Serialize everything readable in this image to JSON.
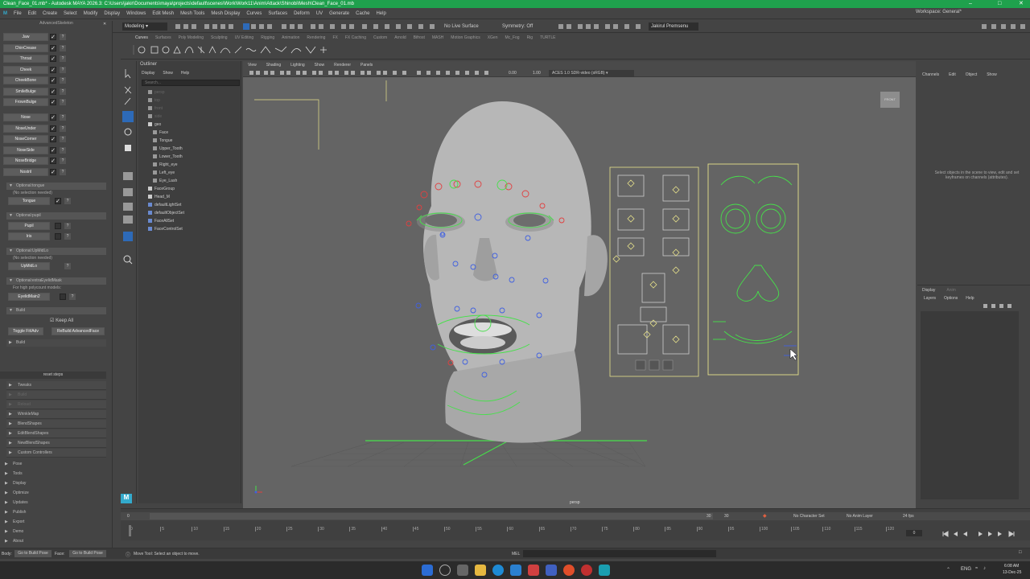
{
  "window": {
    "title": "Clean_Face_01.mb* - Autodesk MAYA 2026.3: C:\\Users\\jakir\\Documents\\maya\\projects\\default\\scenes\\Work\\Work11\\Anim\\Attack\\Shinobi\\Mesh\\Clean_Face_01.mb",
    "workspace_label": "Workspace:",
    "workspace_value": "General*"
  },
  "menubar": [
    "File",
    "Edit",
    "Create",
    "Select",
    "Modify",
    "Display",
    "Windows",
    "Edit Mesh",
    "Mesh Tools",
    "Mesh Display",
    "Curves",
    "Surfaces",
    "Deform",
    "UV",
    "Generate",
    "Cache",
    "Help"
  ],
  "statusline": {
    "mode": "Modeling",
    "live_surface": "No Live Surface",
    "symmetry": "Symmetry: Off",
    "user": "Jakirul Premsenu"
  },
  "shelf_tabs": [
    "Curves",
    "Surfaces",
    "Poly Modeling",
    "Sculpting",
    "UV Editing",
    "Rigging",
    "Animation",
    "Rendering",
    "FX",
    "FX Caching",
    "Custom",
    "Arnold",
    "Bifrost",
    "MASH",
    "Motion Graphics",
    "XGen",
    "Mc_Fog",
    "Rig",
    "TURTLE"
  ],
  "left_panel": {
    "header": "AdvancedSkeleton",
    "controls1": [
      "Jaw",
      "ChinCrease",
      "Throat",
      "Cheek",
      "CheekBone",
      "SmileBulge",
      "FrownBulge"
    ],
    "controls2": [
      "Nose",
      "NoseUnder",
      "NoseCorner",
      "NoseSide",
      "NoseBridge",
      "Nostril"
    ],
    "tongue_section": "Optional:tongue",
    "tongue_sub": "(No selection needed)",
    "tongue_btn": "Tongue",
    "pupil_section": "Optional:pupil",
    "pupil_btn": "Pupil",
    "iris_btn": "Iris",
    "upmid_section": "Optional:UpMidLo",
    "upmid_sub": "(No selection needed)",
    "upmid_btn": "UpMidLo",
    "extra_section": "Optional:extraEyelidMask",
    "extra_sub": "For high polycount models:",
    "extra_btn": "EyelidMain2",
    "build_section": "Build",
    "keep_all": "Keep All",
    "toggle_btn": "Toggle Fit/Adv",
    "rebuild_btn": "ReBuild AdvancedFace",
    "build_sub": "Build",
    "reset_steps": "reset steps",
    "folds": [
      "Tweaks",
      "Build",
      "Reload",
      "WrinkleMap",
      "BlendShapes",
      "EditBlendShapes",
      "NewBlendShapes",
      "Custom Controllers"
    ],
    "root_folds": [
      "Pose",
      "Tools",
      "Display",
      "Optimize",
      "Updates",
      "Publish",
      "Export",
      "Demo",
      "About"
    ]
  },
  "outliner": {
    "title": "Outliner",
    "menu": [
      "Display",
      "Show",
      "Help"
    ],
    "search_placeholder": "Search...",
    "items": [
      "persp",
      "top",
      "front",
      "side",
      "geo",
      "Face",
      "Tongue",
      "Upper_Tooth",
      "Lower_Tooth",
      "Right_eye",
      "Left_eye",
      "Eye_Lash",
      "FaceGroup",
      "Head_M",
      "defaultLightSet",
      "defaultObjectSet",
      "FaceAllSet",
      "FaceControlSet"
    ]
  },
  "viewport": {
    "menu": [
      "View",
      "Shading",
      "Lighting",
      "Show",
      "Renderer",
      "Panels"
    ],
    "colorspace": "ACES 1.0 SDR-video (sRGB)",
    "num1": "0.00",
    "num2": "1.00",
    "camera": "persp",
    "viewcube": "FRONT"
  },
  "right_panel": {
    "tabs": [
      "Channels",
      "Edit",
      "Object",
      "Show"
    ],
    "message": "Select objects in the scene to view, edit and set keyframes on channels (attributes).",
    "layer_tabs": [
      "Display",
      "Anim"
    ],
    "layer_menu": [
      "Layers",
      "Options",
      "Help"
    ]
  },
  "timeline": {
    "ticks": [
      "0",
      "5",
      "10",
      "15",
      "20",
      "25",
      "30",
      "35",
      "40",
      "45",
      "50",
      "55",
      "60",
      "65",
      "70",
      "75",
      "80",
      "85",
      "90",
      "95",
      "100",
      "105",
      "110",
      "115",
      "120"
    ],
    "start": "0",
    "end_a": "30",
    "end_b": "30",
    "current": "0",
    "character_set": "No Character Set",
    "anim_layer": "No Anim Layer",
    "fps": "24 fps"
  },
  "cmdline": {
    "body_label": "Body:",
    "body_btn": "Go to Build Pose",
    "face_label": "Face:",
    "face_btn": "Go to Build Pose",
    "help": "Move Tool: Select an object to move.",
    "mel": "MEL"
  },
  "taskbar": {
    "lang": "ENG",
    "time": "6:08 AM",
    "date": "13-Dec-25"
  },
  "colors": {
    "title_green": "#1fa14d",
    "ctrl_green": "#46e04a",
    "ctrl_red": "#e04040",
    "ctrl_blue": "#4060e0",
    "ctrl_yellow": "#e6e08a"
  }
}
